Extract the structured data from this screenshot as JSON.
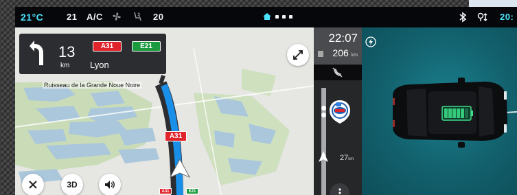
{
  "status_bar": {
    "cabin_temp": "21°C",
    "fan_speed": "21",
    "ac_label": "A/C",
    "fan_icon": "fan-icon",
    "seat_icon": "seat-airflow-icon",
    "set_temp": "20",
    "home_icon": "home-icon",
    "bluetooth_icon": "bluetooth-icon",
    "gps_icon": "gps-icon",
    "clock": "20:"
  },
  "navigation": {
    "maneuver_icon": "turn-left-arrow-icon",
    "distance": "13",
    "distance_unit": "km",
    "destination_city": "Lyon",
    "road_signs": [
      "A31",
      "E21"
    ],
    "map_place_label": "Ruisseau de la Grande Noue Noire",
    "route_road_label": "A31",
    "mini_signs": [
      "A31",
      "E21"
    ],
    "buttons": {
      "expand_icon": "expand-icon",
      "close_icon": "close-icon",
      "view_mode_label": "3D",
      "sound_icon": "speaker-icon"
    }
  },
  "route_panel": {
    "eta": "22:07",
    "remaining_distance": "206",
    "remaining_unit": "km",
    "no_phone_icon": "phone-off-icon",
    "poi_icon": "fuel-station-pin-icon",
    "next_distance": "27",
    "next_distance_unit": "km",
    "menu_icon": "more-vertical-icon"
  },
  "vehicle_panel": {
    "charging_icon": "lightning-icon",
    "vehicle_image": "car-battery-charging-icon",
    "battery_level": 0.8
  },
  "colors": {
    "accent_cyan": "#4ae4ff",
    "route_blue": "#1a8fe8",
    "sign_red": "#e0242c",
    "sign_green": "#1c9b3e",
    "vehicle_teal": "#136673"
  }
}
